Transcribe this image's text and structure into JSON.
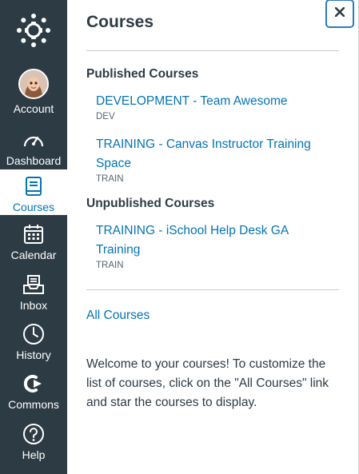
{
  "colors": {
    "nav_bg": "#2d3b45",
    "link": "#0374b5",
    "active_nav_text": "#0374b5",
    "text": "#2d3b45"
  },
  "nav": {
    "logo_icon": "canvas-logo-icon",
    "items": [
      {
        "label": "Account",
        "icon": "avatar"
      },
      {
        "label": "Dashboard",
        "icon": "speedometer-icon"
      },
      {
        "label": "Courses",
        "icon": "book-icon",
        "active": true
      },
      {
        "label": "Calendar",
        "icon": "calendar-icon"
      },
      {
        "label": "Inbox",
        "icon": "inbox-icon"
      },
      {
        "label": "History",
        "icon": "clock-icon"
      },
      {
        "label": "Commons",
        "icon": "commons-icon"
      },
      {
        "label": "Help",
        "icon": "help-icon"
      }
    ]
  },
  "tray": {
    "title": "Courses",
    "close_icon": "close-icon",
    "published_heading": "Published Courses",
    "published": [
      {
        "name": "DEVELOPMENT - Team Awesome",
        "code": "DEV"
      },
      {
        "name": "TRAINING - Canvas Instructor Training Space",
        "code": "TRAIN"
      }
    ],
    "unpublished_heading": "Unpublished Courses",
    "unpublished": [
      {
        "name": "TRAINING - iSchool Help Desk GA Training",
        "code": "TRAIN"
      }
    ],
    "all_courses": "All Courses",
    "welcome": "Welcome to your courses! To customize the list of courses, click on the \"All Courses\" link and star the courses to display."
  }
}
